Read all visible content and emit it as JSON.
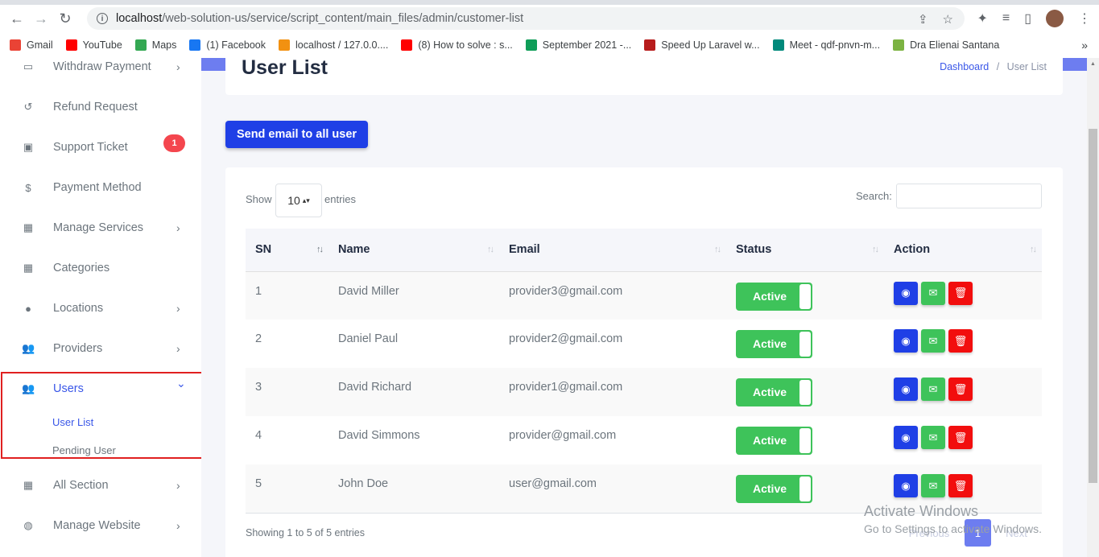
{
  "browser": {
    "url_host": "localhost",
    "url_path": "/web-solution-us/service/script_content/main_files/admin/customer-list",
    "bookmarks": [
      {
        "label": "Gmail",
        "color": "#ea4335"
      },
      {
        "label": "YouTube",
        "color": "#ff0000"
      },
      {
        "label": "Maps",
        "color": "#34a853"
      },
      {
        "label": "(1) Facebook",
        "color": "#1877f2"
      },
      {
        "label": "localhost / 127.0.0....",
        "color": "#f29111"
      },
      {
        "label": "(8) How to solve : s...",
        "color": "#ff0000"
      },
      {
        "label": "September 2021 -...",
        "color": "#0f9d58"
      },
      {
        "label": "Speed Up Laravel w...",
        "color": "#b71c1c"
      },
      {
        "label": "Meet - qdf-pnvn-m...",
        "color": "#00897b"
      },
      {
        "label": "Dra Elienai Santana",
        "color": "#7cb342"
      }
    ],
    "more": "»"
  },
  "sidebar": {
    "items": [
      {
        "label": "Withdraw Payment",
        "icon": "credit-card-icon",
        "chevron": "›"
      },
      {
        "label": "Refund Request",
        "icon": "undo-icon",
        "chevron": ""
      },
      {
        "label": "Support Ticket",
        "icon": "ticket-icon",
        "chevron": ""
      },
      {
        "label": "Payment Method",
        "icon": "dollar-icon",
        "chevron": ""
      },
      {
        "label": "Manage Services",
        "icon": "grid-icon",
        "chevron": "›"
      },
      {
        "label": "Categories",
        "icon": "grid-icon",
        "chevron": ""
      },
      {
        "label": "Locations",
        "icon": "map-marker-icon",
        "chevron": "›"
      },
      {
        "label": "Providers",
        "icon": "users-icon",
        "chevron": "›"
      },
      {
        "label": "Users",
        "icon": "users-icon",
        "chevron": "⌄"
      },
      {
        "label": "All Section",
        "icon": "grid-icon",
        "chevron": "›"
      },
      {
        "label": "Manage Website",
        "icon": "globe-icon",
        "chevron": "›"
      }
    ],
    "support_badge": "1",
    "sub_items": [
      "User List",
      "Pending User"
    ]
  },
  "header": {
    "title": "User List",
    "breadcrumb_home": "Dashboard",
    "breadcrumb_sep": "/",
    "breadcrumb_current": "User List"
  },
  "actions": {
    "send_email": "Send email to all user"
  },
  "table_controls": {
    "show": "Show",
    "entries_value": "10",
    "entries": "entries",
    "search": "Search:"
  },
  "table": {
    "columns": [
      "SN",
      "Name",
      "Email",
      "Status",
      "Action"
    ],
    "rows": [
      {
        "sn": "1",
        "name": "David Miller",
        "email": "provider3@gmail.com",
        "status": "Active"
      },
      {
        "sn": "2",
        "name": "Daniel Paul",
        "email": "provider2@gmail.com",
        "status": "Active"
      },
      {
        "sn": "3",
        "name": "David Richard",
        "email": "provider1@gmail.com",
        "status": "Active"
      },
      {
        "sn": "4",
        "name": "David Simmons",
        "email": "provider@gmail.com",
        "status": "Active"
      },
      {
        "sn": "5",
        "name": "John Doe",
        "email": "user@gmail.com",
        "status": "Active"
      }
    ]
  },
  "footer": {
    "info": "Showing 1 to 5 of 5 entries",
    "previous": "Previous",
    "page": "1",
    "next": "Next"
  },
  "watermark": {
    "line1": "Activate Windows",
    "line2": "Go to Settings to activate Windows."
  }
}
